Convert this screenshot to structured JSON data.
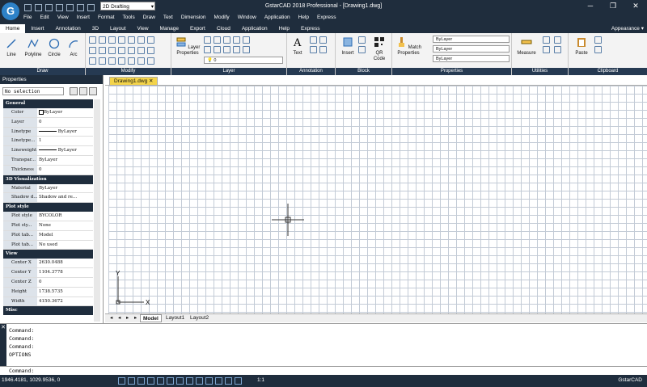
{
  "app": {
    "title": "GstarCAD 2018 Professional - [Drawing1.dwg]",
    "workspace": "2D Drafting",
    "logo": "G"
  },
  "menu": [
    "File",
    "Edit",
    "View",
    "Insert",
    "Format",
    "Tools",
    "Draw",
    "Text",
    "Dimension",
    "Modify",
    "Window",
    "Application",
    "Help",
    "Express"
  ],
  "ribbon_tabs": [
    "Home",
    "Insert",
    "Annotation",
    "3D",
    "Layout",
    "View",
    "Manage",
    "Export",
    "Cloud",
    "Application",
    "Help",
    "Express"
  ],
  "appearance": "Appearance",
  "panels": {
    "draw": "Draw",
    "modify": "Modify",
    "layer": "Layer",
    "annotation": "Annotation",
    "block": "Block",
    "properties": "Properties",
    "utilities": "Utilities",
    "clipboard": "Clipboard"
  },
  "tools": {
    "line": "Line",
    "polyline": "Polyline",
    "circle": "Circle",
    "arc": "Arc",
    "layer_properties_1": "Layer",
    "layer_properties_2": "Properties",
    "text": "Text",
    "insert": "Insert",
    "qr_1": "QR",
    "qr_2": "Code",
    "match_1": "Match",
    "match_2": "Properties",
    "measure": "Measure",
    "paste": "Paste",
    "bylayer1": "ByLayer",
    "bylayer2": "ByLayer",
    "bylayer3": "ByLayer",
    "layer_value": "0"
  },
  "properties_panel": {
    "title": "Properties",
    "selection": "No selection",
    "general_label": "General",
    "general": [
      [
        "Color",
        "ByLayer"
      ],
      [
        "Layer",
        "0"
      ],
      [
        "Linetype",
        "ByLayer"
      ],
      [
        "Linetype...",
        "1"
      ],
      [
        "Lineweight",
        "ByLayer"
      ],
      [
        "Transpar...",
        "ByLayer"
      ],
      [
        "Thickness",
        "0"
      ]
    ],
    "viz_label": "3D Visualization",
    "viz": [
      [
        "Material",
        "ByLayer"
      ],
      [
        "Shadow d...",
        "Shadow and re..."
      ]
    ],
    "plot_label": "Plot style",
    "plot": [
      [
        "Plot style",
        "BYCOLOR"
      ],
      [
        "Plot sty...",
        "None"
      ],
      [
        "Plot tab...",
        "Model"
      ],
      [
        "Plot tab...",
        "No used"
      ]
    ],
    "view_label": "View",
    "view": [
      [
        "Center X",
        "2630.0488"
      ],
      [
        "Center Y",
        "1104.3778"
      ],
      [
        "Center Z",
        "0"
      ],
      [
        "Height",
        "1738.5735"
      ],
      [
        "Width",
        "4150.3672"
      ]
    ],
    "misc_label": "Misc"
  },
  "document_tab": "Drawing1.dwg",
  "layout_tabs": [
    "Model",
    "Layout1",
    "Layout2"
  ],
  "command_history": [
    "Command:",
    "Command:",
    "Command:",
    "OPTIONS"
  ],
  "command_prompt": "Command:",
  "status": {
    "coords": "1946.4181, 1029.9536, 0",
    "scale": "1:1",
    "app": "GstarCAD"
  },
  "ucs": {
    "y": "Y",
    "x": "X"
  },
  "colors": {
    "dark": "#1f2d3d",
    "accent": "#2e82c8",
    "tab_active": "#f4d44a"
  }
}
